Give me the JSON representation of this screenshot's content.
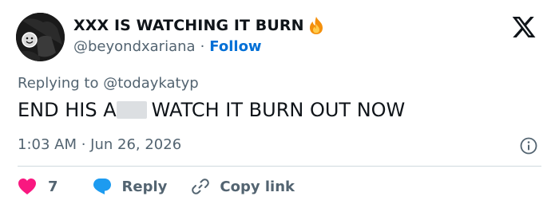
{
  "author": {
    "display_name": "XXX IS WATCHING IT BURN",
    "name_emoji": "fire-icon",
    "handle": "@beyondxariana",
    "separator": "·",
    "follow_label": "Follow"
  },
  "tweet": {
    "replying_prefix": "Replying to",
    "replying_handle": "@todaykatyp",
    "text_before": "END HIS A",
    "text_after": "WATCH IT BURN OUT NOW",
    "timestamp": "1:03 AM · Jun 26, 2026"
  },
  "actions": {
    "like_count": "7",
    "reply_label": "Reply",
    "copy_label": "Copy link"
  },
  "colors": {
    "like": "#f91880",
    "reply": "#1d9bf0",
    "follow": "#006fd6",
    "muted": "#536471"
  }
}
